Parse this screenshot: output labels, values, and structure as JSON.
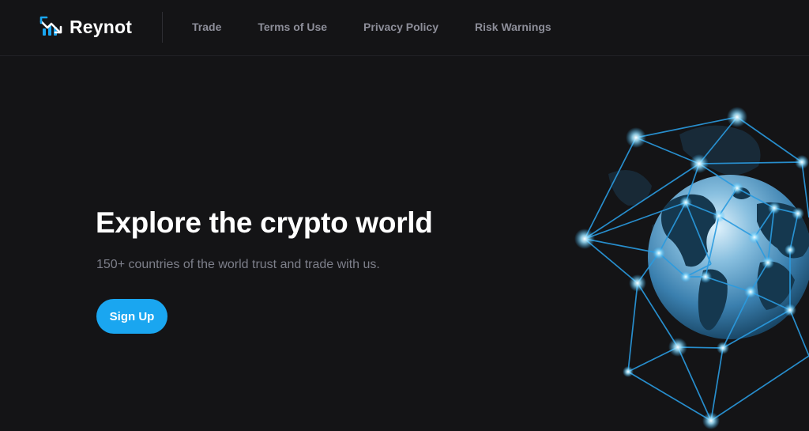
{
  "brand": {
    "name": "Reynot",
    "logo_icon": "chart-trend-icon"
  },
  "nav": {
    "items": [
      "Trade",
      "Terms of Use",
      "Privacy Policy",
      "Risk Warnings"
    ]
  },
  "hero": {
    "title": "Explore the crypto world",
    "subtitle": "150+ countries of the world trust and trade with us.",
    "cta_label": "Sign Up",
    "illustration": "network-globe-illustration"
  },
  "colors": {
    "background": "#141416",
    "accent": "#1aa6f0",
    "text_primary": "#ffffff",
    "text_muted": "#7d7f8a",
    "nav_text": "#8d8e99"
  }
}
